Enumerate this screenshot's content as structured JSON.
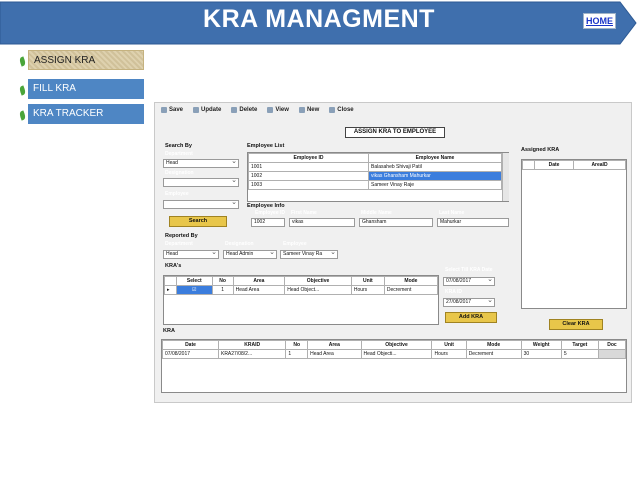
{
  "header": {
    "title": "KRA MANAGMENT",
    "home_label": "HOME",
    "banner_color": "#3f6fad"
  },
  "menu": [
    {
      "label": "ASSIGN KRA",
      "active": true
    },
    {
      "label": "FILL KRA",
      "active": false
    },
    {
      "label": "KRA TRACKER",
      "active": false
    }
  ],
  "toolbar": [
    "Save",
    "Update",
    "Delete",
    "View",
    "New",
    "Close"
  ],
  "form_title": "ASSIGN KRA TO EMPLOYEE",
  "search": {
    "label": "Search By",
    "dept_label": "Department",
    "dept_value": "Head",
    "designation_label": "Designation",
    "designation_value": "",
    "employee_label": "Employee",
    "employee_value": "",
    "button": "Search"
  },
  "employee_list": {
    "label": "Employee List",
    "headers": [
      "Employee ID",
      "Employee Name"
    ],
    "rows": [
      [
        "1001",
        "Balasaheb Shivaji Patil"
      ],
      [
        "1002",
        "vikas Ghansham Mahurkar"
      ],
      [
        "1003",
        "Sameer Vinay Raje"
      ]
    ]
  },
  "employee_info": {
    "label": "Employee Info",
    "id_label": "Employee ID",
    "id_value": "1002",
    "first_label": "First Name",
    "first_value": "vikas",
    "middle_label": "Middle Name",
    "middle_value": "Ghansham",
    "last_label": "Last Name",
    "last_value": "Mahurkar"
  },
  "reported_by": {
    "label": "Reported By",
    "dept_label": "Department",
    "dept_value": "Head",
    "desig_label": "Designation",
    "desig_value": "Head Admin",
    "emp_label": "Employee",
    "emp_value": "Sameer Vinay Ra"
  },
  "kras": {
    "label": "KRA's",
    "headers": [
      "Select",
      "No",
      "Area",
      "Objective",
      "Unit",
      "Mode"
    ],
    "rows": [
      [
        "",
        "1",
        "Head Area",
        "Head Object...",
        "Hours",
        "Decrement"
      ]
    ]
  },
  "dates": {
    "select_till_label": "Select Till  KRA Date",
    "till_value": "07/08/2017",
    "kra_id_label": "KRA ID",
    "kra_id_value": "27/08/2017",
    "add_button": "Add KRA"
  },
  "assigned": {
    "label": "Assigned KRA",
    "headers": [
      "Date",
      "AreaID"
    ],
    "clear_button": "Clear KRA"
  },
  "kra_table": {
    "label": "KRA",
    "headers": [
      "Date",
      "KRAID",
      "No",
      "Area",
      "Objective",
      "Unit",
      "Mode",
      "Weight",
      "Target",
      "Doc"
    ],
    "rows": [
      [
        "07/08/2017",
        "KRA27/08/2...",
        "1",
        "Head Area",
        "Head Objecti...",
        "Hours",
        "Decrement",
        "30",
        "5",
        ""
      ]
    ]
  }
}
